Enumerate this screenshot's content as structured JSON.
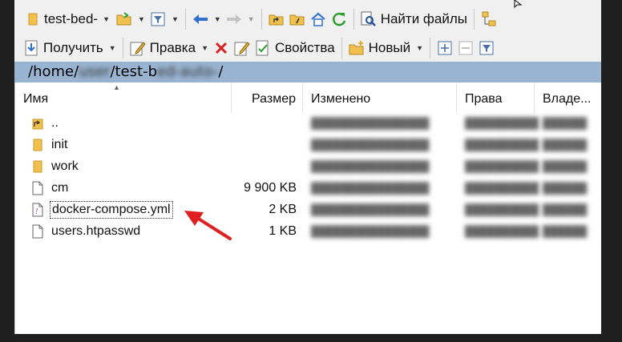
{
  "toolbar1": {
    "drive_combo": "test-bed-",
    "find_files_label": "Найти файлы"
  },
  "toolbar2": {
    "download_label": "Получить",
    "edit_label": "Правка",
    "properties_label": "Свойства",
    "new_label": "Новый"
  },
  "path": {
    "text_start": "/home/",
    "redacted1": "user",
    "text_mid": "/test-b",
    "redacted2": "ed-auto-",
    "text_end": "/"
  },
  "columns": {
    "name": "Имя",
    "size": "Размер",
    "modified": "Изменено",
    "rights": "Права",
    "owner": "Владе..."
  },
  "files": [
    {
      "name": "..",
      "size": "",
      "type": "parent"
    },
    {
      "name": "init",
      "size": "",
      "type": "folder"
    },
    {
      "name": "work",
      "size": "",
      "type": "folder"
    },
    {
      "name": "cm",
      "size": "9 900 KB",
      "type": "file"
    },
    {
      "name": "docker-compose.yml",
      "size": "2 KB",
      "type": "yml"
    },
    {
      "name": "users.htpasswd",
      "size": "1 KB",
      "type": "file"
    }
  ],
  "colors": {
    "path_bar": "#99b4d1",
    "arrow": "#e02020",
    "folder": "#f2c04c",
    "back_arrow": "#2f6fd0",
    "delete": "#d42020"
  }
}
